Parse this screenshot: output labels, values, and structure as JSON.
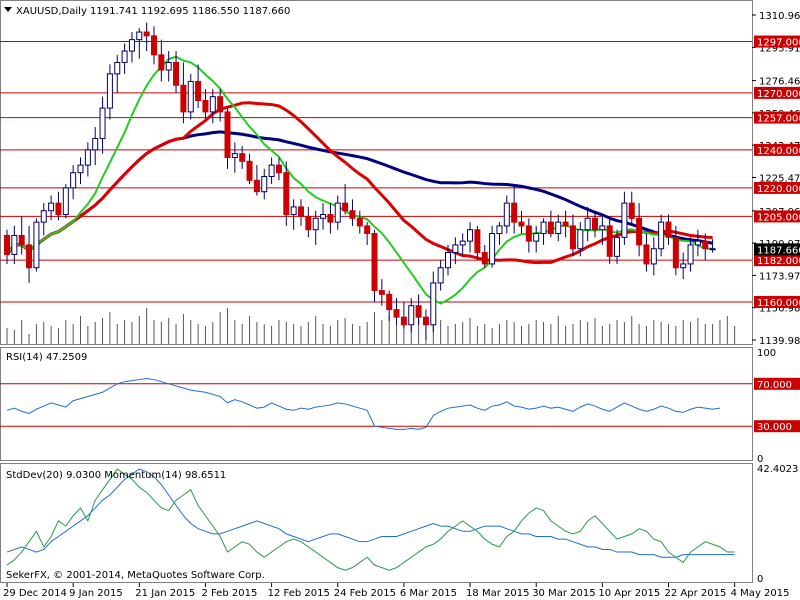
{
  "header": {
    "symbol_label": "XAUUSD,Daily",
    "ohlc": "1191.741 1192.695 1186.550 1187.660"
  },
  "copyright": "SekerFX, © 2001-2014, MetaQuotes Software Corp.",
  "colors": {
    "up_candle": "#ffffff",
    "down_candle": "#cc0000",
    "candle_outline": "#000066",
    "ma_slow": "#000080",
    "ma_mid": "#dd0000",
    "ma_fast": "#22cc22",
    "level_line": "#cc0000",
    "rsi": "#1e6fd0",
    "stddev": "#1e6fd0",
    "momentum": "#2a9a4a",
    "grid_separator": "#808080"
  },
  "chart_data": [
    {
      "type": "candlestick",
      "panel": "price",
      "price_scale_ticks": [
        "1310.965",
        "1293.915",
        "1276.460",
        "1259.465",
        "1242.470",
        "1225.475",
        "1207.965",
        "1190.970",
        "1173.975",
        "1156.980",
        "1139.985"
      ],
      "ylim": [
        1139.985,
        1310.965
      ],
      "current_price": "1187.660",
      "levels": [
        "1297.000",
        "1270.000",
        "1257.000",
        "1240.000",
        "1220.000",
        "1205.000",
        "1182.000",
        "1160.000"
      ],
      "x_ticks": [
        "29 Dec 2014",
        "9 Jan 2015",
        "21 Jan 2015",
        "2 Feb 2015",
        "12 Feb 2015",
        "24 Feb 2015",
        "6 Mar 2015",
        "18 Mar 2015",
        "30 Mar 2015",
        "10 Apr 2015",
        "22 Apr 2015",
        "4 May 2015"
      ],
      "x_tick_index": [
        0,
        9,
        18,
        27,
        36,
        45,
        54,
        63,
        72,
        81,
        90,
        99
      ],
      "ohlc": [
        [
          1195,
          1198,
          1180,
          1185
        ],
        [
          1185,
          1200,
          1180,
          1195
        ],
        [
          1195,
          1205,
          1185,
          1190
        ],
        [
          1190,
          1200,
          1170,
          1178
        ],
        [
          1178,
          1204,
          1176,
          1202
        ],
        [
          1202,
          1212,
          1195,
          1208
        ],
        [
          1208,
          1216,
          1203,
          1212
        ],
        [
          1212,
          1218,
          1203,
          1206
        ],
        [
          1206,
          1222,
          1204,
          1220
        ],
        [
          1220,
          1232,
          1214,
          1228
        ],
        [
          1228,
          1236,
          1222,
          1232
        ],
        [
          1232,
          1244,
          1226,
          1240
        ],
        [
          1240,
          1252,
          1232,
          1246
        ],
        [
          1246,
          1268,
          1238,
          1262
        ],
        [
          1262,
          1285,
          1256,
          1280
        ],
        [
          1280,
          1290,
          1270,
          1286
        ],
        [
          1286,
          1296,
          1280,
          1292
        ],
        [
          1292,
          1302,
          1286,
          1298
        ],
        [
          1298,
          1304,
          1288,
          1302
        ],
        [
          1302,
          1307,
          1292,
          1300
        ],
        [
          1300,
          1305,
          1285,
          1290
        ],
        [
          1290,
          1298,
          1276,
          1282
        ],
        [
          1282,
          1292,
          1276,
          1286
        ],
        [
          1286,
          1292,
          1270,
          1274
        ],
        [
          1274,
          1286,
          1254,
          1260
        ],
        [
          1260,
          1280,
          1256,
          1276
        ],
        [
          1276,
          1285,
          1262,
          1266
        ],
        [
          1266,
          1272,
          1256,
          1260
        ],
        [
          1260,
          1272,
          1254,
          1268
        ],
        [
          1268,
          1272,
          1255,
          1260
        ],
        [
          1260,
          1262,
          1230,
          1236
        ],
        [
          1236,
          1244,
          1228,
          1238
        ],
        [
          1238,
          1242,
          1230,
          1234
        ],
        [
          1234,
          1238,
          1222,
          1224
        ],
        [
          1224,
          1232,
          1216,
          1218
        ],
        [
          1218,
          1230,
          1214,
          1226
        ],
        [
          1226,
          1236,
          1222,
          1232
        ],
        [
          1232,
          1236,
          1224,
          1228
        ],
        [
          1228,
          1234,
          1200,
          1206
        ],
        [
          1206,
          1214,
          1198,
          1210
        ],
        [
          1210,
          1214,
          1200,
          1205
        ],
        [
          1205,
          1210,
          1194,
          1198
        ],
        [
          1198,
          1208,
          1190,
          1204
        ],
        [
          1204,
          1212,
          1198,
          1206
        ],
        [
          1206,
          1212,
          1196,
          1202
        ],
        [
          1202,
          1216,
          1198,
          1212
        ],
        [
          1212,
          1222,
          1206,
          1208
        ],
        [
          1208,
          1214,
          1200,
          1204
        ],
        [
          1204,
          1208,
          1196,
          1200
        ],
        [
          1200,
          1202,
          1190,
          1196
        ],
        [
          1196,
          1198,
          1160,
          1166
        ],
        [
          1166,
          1172,
          1158,
          1164
        ],
        [
          1164,
          1166,
          1150,
          1156
        ],
        [
          1156,
          1162,
          1148,
          1152
        ],
        [
          1152,
          1160,
          1146,
          1148
        ],
        [
          1148,
          1162,
          1144,
          1158
        ],
        [
          1158,
          1164,
          1148,
          1152
        ],
        [
          1152,
          1156,
          1140,
          1148
        ],
        [
          1148,
          1176,
          1144,
          1170
        ],
        [
          1170,
          1182,
          1166,
          1178
        ],
        [
          1178,
          1190,
          1174,
          1186
        ],
        [
          1186,
          1194,
          1180,
          1190
        ],
        [
          1190,
          1196,
          1184,
          1192
        ],
        [
          1192,
          1202,
          1186,
          1198
        ],
        [
          1198,
          1200,
          1182,
          1186
        ],
        [
          1186,
          1190,
          1178,
          1180
        ],
        [
          1180,
          1200,
          1178,
          1196
        ],
        [
          1196,
          1202,
          1190,
          1200
        ],
        [
          1200,
          1216,
          1196,
          1212
        ],
        [
          1212,
          1222,
          1196,
          1202
        ],
        [
          1202,
          1208,
          1196,
          1200
        ],
        [
          1200,
          1204,
          1186,
          1192
        ],
        [
          1192,
          1200,
          1186,
          1196
        ],
        [
          1196,
          1204,
          1190,
          1202
        ],
        [
          1202,
          1208,
          1194,
          1196
        ],
        [
          1196,
          1206,
          1192,
          1202
        ],
        [
          1202,
          1208,
          1194,
          1200
        ],
        [
          1200,
          1206,
          1184,
          1188
        ],
        [
          1188,
          1202,
          1184,
          1198
        ],
        [
          1198,
          1210,
          1192,
          1204
        ],
        [
          1204,
          1208,
          1194,
          1198
        ],
        [
          1198,
          1206,
          1190,
          1200
        ],
        [
          1200,
          1204,
          1180,
          1184
        ],
        [
          1184,
          1198,
          1180,
          1194
        ],
        [
          1194,
          1218,
          1190,
          1212
        ],
        [
          1212,
          1218,
          1200,
          1204
        ],
        [
          1204,
          1212,
          1184,
          1190
        ],
        [
          1190,
          1196,
          1176,
          1180
        ],
        [
          1180,
          1194,
          1174,
          1188
        ],
        [
          1188,
          1206,
          1184,
          1202
        ],
        [
          1202,
          1206,
          1190,
          1194
        ],
        [
          1194,
          1200,
          1174,
          1178
        ],
        [
          1178,
          1186,
          1172,
          1180
        ],
        [
          1180,
          1194,
          1176,
          1190
        ],
        [
          1190,
          1198,
          1184,
          1192
        ],
        [
          1192,
          1196,
          1182,
          1188
        ],
        [
          1188,
          1193,
          1186,
          1188
        ]
      ],
      "volume": [
        8,
        7,
        12,
        5,
        10,
        11,
        9,
        8,
        12,
        10,
        14,
        9,
        11,
        13,
        16,
        10,
        12,
        11,
        14,
        18,
        12,
        11,
        13,
        10,
        15,
        12,
        10,
        9,
        11,
        16,
        18,
        12,
        10,
        14,
        11,
        10,
        9,
        12,
        11,
        10,
        9,
        11,
        14,
        10,
        9,
        12,
        13,
        10,
        9,
        11,
        16,
        12,
        14,
        10,
        12,
        9,
        18,
        11,
        10,
        12,
        9,
        10,
        11,
        13,
        9,
        10,
        8,
        10,
        12,
        11,
        9,
        10,
        12,
        11,
        10,
        14,
        9,
        10,
        12,
        11,
        13,
        9,
        10,
        12,
        11,
        14,
        10,
        9,
        12,
        11,
        10,
        9,
        12,
        11,
        13,
        10,
        10,
        12,
        14,
        9
      ]
    },
    {
      "type": "line",
      "panel": "rsi",
      "header": "RSI(14) 47.2509",
      "ticks": [
        "100",
        "70.000",
        "30.000",
        "0"
      ],
      "ylim": [
        0,
        100
      ],
      "levels": [
        70,
        30
      ],
      "series": [
        {
          "values": [
            45,
            47,
            44,
            42,
            46,
            49,
            52,
            50,
            48,
            54,
            56,
            58,
            60,
            62,
            66,
            70,
            72,
            73,
            74,
            75,
            74,
            72,
            70,
            68,
            66,
            64,
            63,
            62,
            60,
            58,
            52,
            55,
            53,
            50,
            47,
            48,
            52,
            49,
            46,
            45,
            47,
            46,
            48,
            49,
            50,
            52,
            51,
            49,
            47,
            45,
            30,
            29,
            28,
            27,
            27,
            28,
            27,
            29,
            40,
            44,
            47,
            48,
            49,
            50,
            47,
            45,
            49,
            50,
            53,
            49,
            48,
            46,
            47,
            49,
            47,
            48,
            46,
            44,
            48,
            51,
            49,
            46,
            44,
            48,
            52,
            49,
            46,
            44,
            46,
            49,
            47,
            44,
            43,
            46,
            48,
            47,
            46,
            47
          ]
        }
      ]
    },
    {
      "type": "line",
      "panel": "stddev_momentum",
      "header": "StdDev(20) 9.0300  Momentum(14) 98.6511",
      "ticks": [
        "42.4023",
        "0"
      ],
      "ylim": [
        0,
        42.4023
      ],
      "series": [
        {
          "name": "StdDev(20)",
          "values": [
            10,
            11,
            12,
            11,
            10,
            11,
            14,
            16,
            18,
            20,
            22,
            24,
            27,
            30,
            32,
            35,
            38,
            40,
            42,
            41,
            39,
            36,
            32,
            28,
            24,
            21,
            19,
            18,
            17,
            17,
            18,
            19,
            20,
            21,
            22,
            21,
            20,
            19,
            17,
            16,
            15,
            14,
            15,
            16,
            17,
            17,
            16,
            15,
            14,
            14,
            15,
            16,
            16,
            16,
            17,
            18,
            19,
            20,
            21,
            20,
            20,
            19,
            18,
            18,
            19,
            20,
            20,
            20,
            19,
            18,
            17,
            17,
            16,
            16,
            16,
            15,
            15,
            14,
            13,
            12,
            12,
            11,
            11,
            10,
            10,
            10,
            9,
            9,
            9,
            8,
            8,
            8,
            9,
            9,
            9,
            9,
            9,
            9,
            9,
            9
          ]
        },
        {
          "name": "Momentum(14)",
          "values": [
            5,
            7,
            10,
            14,
            18,
            12,
            16,
            22,
            20,
            24,
            27,
            22,
            30,
            34,
            38,
            42,
            40,
            38,
            35,
            33,
            30,
            27,
            26,
            30,
            32,
            34,
            28,
            24,
            20,
            16,
            10,
            12,
            14,
            13,
            10,
            8,
            10,
            12,
            14,
            15,
            14,
            12,
            10,
            8,
            6,
            4,
            3,
            4,
            6,
            8,
            5,
            4,
            3,
            4,
            6,
            8,
            10,
            12,
            13,
            15,
            18,
            20,
            22,
            20,
            18,
            15,
            13,
            12,
            16,
            18,
            22,
            25,
            27,
            26,
            22,
            20,
            18,
            17,
            18,
            22,
            24,
            21,
            18,
            15,
            16,
            17,
            19,
            18,
            15,
            14,
            10,
            8,
            6,
            10,
            12,
            14,
            13,
            12,
            10,
            10
          ]
        }
      ]
    }
  ]
}
